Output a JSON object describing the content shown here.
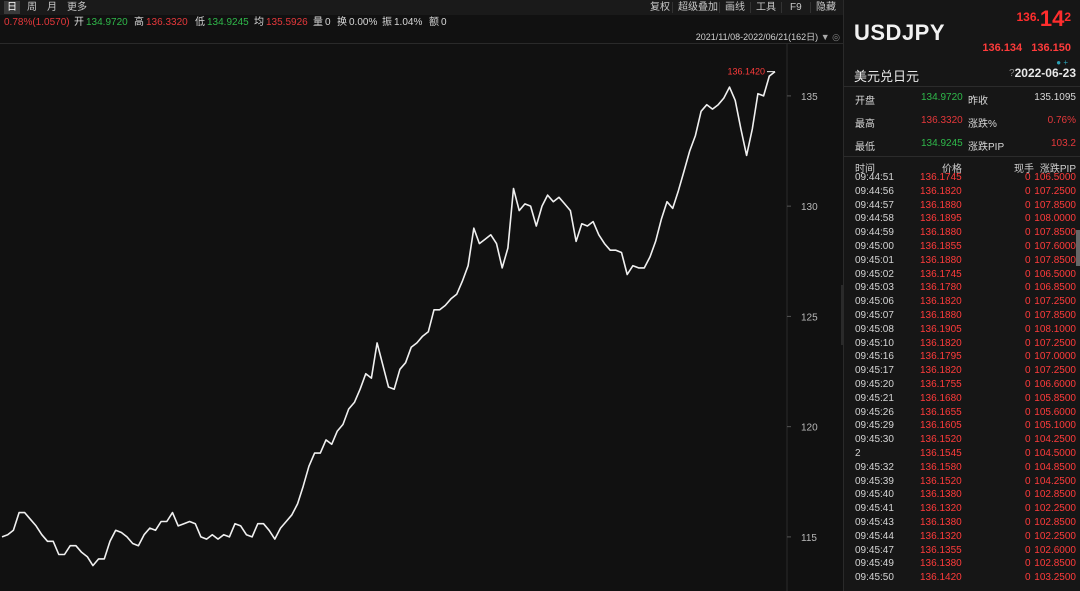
{
  "toolbar": {
    "periods": [
      "日",
      "周",
      "月",
      "更多"
    ],
    "tools": [
      "复权",
      "超级叠加",
      "画线",
      "工具",
      "F9",
      "隐藏"
    ]
  },
  "info": {
    "change_pct": "0.78%(1.0570)",
    "open_label": "开",
    "open": "134.9720",
    "high_label": "高",
    "high": "136.3320",
    "low_label": "低",
    "low": "134.9245",
    "avg_label": "均",
    "avg": "135.5926",
    "vol_label": "量",
    "vol": "0",
    "turnover_label": "换",
    "turnover": "0.00%",
    "amp_label": "振",
    "amp": "1.04%",
    "amount_label": "额",
    "amount": "0"
  },
  "range_label": "2021/11/08-2022/06/21(162日)",
  "chart_data": {
    "type": "line",
    "ylim": [
      113.0,
      136.9
    ],
    "yticks": [
      "135",
      "130",
      "125",
      "120",
      "115"
    ],
    "last_label": "136.1420",
    "values": [
      115.0,
      115.1,
      115.3,
      116.1,
      116.1,
      115.8,
      115.5,
      115.1,
      114.8,
      114.8,
      114.2,
      114.2,
      114.6,
      114.6,
      114.3,
      114.1,
      113.7,
      114.0,
      114.0,
      114.8,
      115.3,
      115.2,
      115.0,
      114.7,
      114.6,
      115.1,
      115.4,
      115.3,
      115.7,
      115.7,
      116.1,
      115.5,
      115.6,
      115.7,
      115.6,
      115.0,
      114.9,
      115.1,
      114.9,
      115.1,
      115.0,
      115.6,
      115.5,
      115.1,
      115.0,
      115.6,
      115.6,
      115.3,
      114.9,
      115.4,
      115.7,
      116.0,
      116.5,
      117.3,
      118.2,
      118.8,
      118.8,
      119.4,
      119.2,
      119.8,
      120.1,
      120.8,
      121.1,
      121.7,
      122.4,
      122.2,
      123.8,
      122.8,
      121.8,
      121.7,
      122.6,
      122.9,
      123.6,
      123.8,
      124.1,
      124.3,
      125.3,
      125.3,
      125.5,
      125.8,
      126.0,
      126.6,
      127.3,
      129.0,
      128.3,
      128.5,
      128.7,
      128.3,
      127.2,
      128.1,
      130.8,
      129.8,
      130.1,
      130.0,
      129.1,
      130.0,
      130.5,
      130.2,
      130.4,
      130.1,
      129.8,
      128.4,
      129.2,
      129.1,
      129.3,
      128.7,
      128.3,
      128.0,
      128.0,
      127.9,
      126.9,
      127.3,
      127.2,
      127.2,
      127.7,
      128.4,
      129.4,
      130.2,
      129.9,
      130.7,
      131.6,
      132.5,
      133.2,
      134.3,
      134.6,
      134.4,
      134.6,
      134.9,
      135.4,
      134.8,
      133.5,
      132.3,
      133.5,
      135.1,
      135.0,
      135.9,
      136.1
    ]
  },
  "panel": {
    "symbol": "USDJPY",
    "price_a": "136.",
    "price_b": "14",
    "price_c": "2",
    "bid": "136.134",
    "ask": "136.150",
    "dots": "● +",
    "name": "美元兑日元",
    "help": "?",
    "date": "2022-06-23",
    "stats": {
      "open_label": "开盘",
      "open": "134.9720",
      "prev_label": "昨收",
      "prev": "135.1095",
      "high_label": "最高",
      "high": "136.3320",
      "chg_label": "涨跌%",
      "chg": "0.76%",
      "low_label": "最低",
      "low": "134.9245",
      "pip_label": "涨跌PIP",
      "pip": "103.2"
    },
    "columns": [
      "时间",
      "价格",
      "现手",
      "涨跌PIP"
    ],
    "ticks": [
      {
        "t": "09:44:51",
        "p": "136.1745",
        "v": "0",
        "pip": "106.5000"
      },
      {
        "t": "09:44:56",
        "p": "136.1820",
        "v": "0",
        "pip": "107.2500"
      },
      {
        "t": "09:44:57",
        "p": "136.1880",
        "v": "0",
        "pip": "107.8500"
      },
      {
        "t": "09:44:58",
        "p": "136.1895",
        "v": "0",
        "pip": "108.0000"
      },
      {
        "t": "09:44:59",
        "p": "136.1880",
        "v": "0",
        "pip": "107.8500"
      },
      {
        "t": "09:45:00",
        "p": "136.1855",
        "v": "0",
        "pip": "107.6000"
      },
      {
        "t": "09:45:01",
        "p": "136.1880",
        "v": "0",
        "pip": "107.8500"
      },
      {
        "t": "09:45:02",
        "p": "136.1745",
        "v": "0",
        "pip": "106.5000"
      },
      {
        "t": "09:45:03",
        "p": "136.1780",
        "v": "0",
        "pip": "106.8500"
      },
      {
        "t": "09:45:06",
        "p": "136.1820",
        "v": "0",
        "pip": "107.2500"
      },
      {
        "t": "09:45:07",
        "p": "136.1880",
        "v": "0",
        "pip": "107.8500"
      },
      {
        "t": "09:45:08",
        "p": "136.1905",
        "v": "0",
        "pip": "108.1000"
      },
      {
        "t": "09:45:10",
        "p": "136.1820",
        "v": "0",
        "pip": "107.2500"
      },
      {
        "t": "09:45:16",
        "p": "136.1795",
        "v": "0",
        "pip": "107.0000"
      },
      {
        "t": "09:45:17",
        "p": "136.1820",
        "v": "0",
        "pip": "107.2500"
      },
      {
        "t": "09:45:20",
        "p": "136.1755",
        "v": "0",
        "pip": "106.6000"
      },
      {
        "t": "09:45:21",
        "p": "136.1680",
        "v": "0",
        "pip": "105.8500"
      },
      {
        "t": "09:45:26",
        "p": "136.1655",
        "v": "0",
        "pip": "105.6000"
      },
      {
        "t": "09:45:29",
        "p": "136.1605",
        "v": "0",
        "pip": "105.1000"
      },
      {
        "t": "09:45:30",
        "p": "136.1520",
        "v": "0",
        "pip": "104.2500"
      },
      {
        "t": "2",
        "p": "136.1545",
        "v": "0",
        "pip": "104.5000"
      },
      {
        "t": "09:45:32",
        "p": "136.1580",
        "v": "0",
        "pip": "104.8500"
      },
      {
        "t": "09:45:39",
        "p": "136.1520",
        "v": "0",
        "pip": "104.2500"
      },
      {
        "t": "09:45:40",
        "p": "136.1380",
        "v": "0",
        "pip": "102.8500"
      },
      {
        "t": "09:45:41",
        "p": "136.1320",
        "v": "0",
        "pip": "102.2500"
      },
      {
        "t": "09:45:43",
        "p": "136.1380",
        "v": "0",
        "pip": "102.8500"
      },
      {
        "t": "09:45:44",
        "p": "136.1320",
        "v": "0",
        "pip": "102.2500"
      },
      {
        "t": "09:45:47",
        "p": "136.1355",
        "v": "0",
        "pip": "102.6000"
      },
      {
        "t": "09:45:49",
        "p": "136.1380",
        "v": "0",
        "pip": "102.8500"
      },
      {
        "t": "09:45:50",
        "p": "136.1420",
        "v": "0",
        "pip": "103.2500"
      }
    ]
  }
}
